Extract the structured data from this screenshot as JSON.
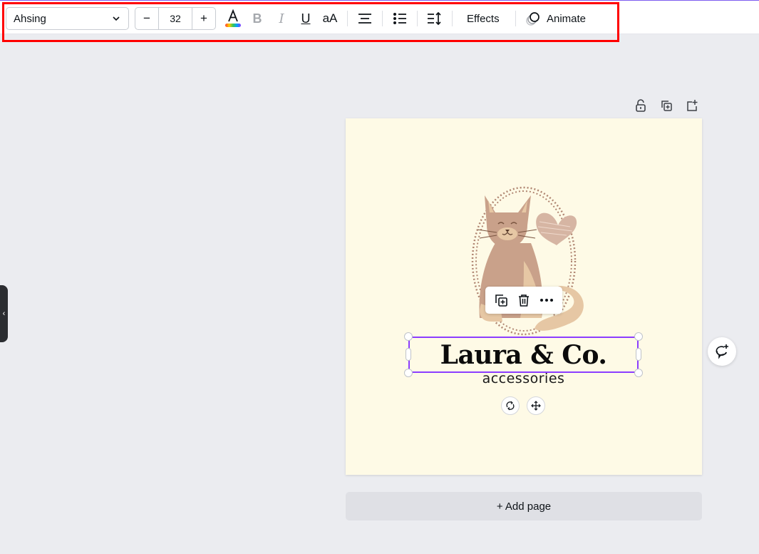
{
  "toolbar": {
    "font_family": "Ahsing",
    "font_size": "32",
    "decrease_label": "−",
    "increase_label": "+",
    "case_label": "aA",
    "effects_label": "Effects",
    "animate_label": "Animate",
    "icons": [
      "text-color-icon",
      "bold-icon",
      "italic-icon",
      "underline-icon",
      "letter-case-icon",
      "align-center-icon",
      "bullet-list-icon",
      "spacing-icon",
      "animate-icon"
    ]
  },
  "page_tools": {
    "icons": [
      "lock-icon",
      "duplicate-page-icon",
      "add-page-icon"
    ]
  },
  "design": {
    "title": "Laura & Co.",
    "subtitle": "accessories",
    "background_color": "#fefae6",
    "selection_color": "#8b3dff"
  },
  "context_menu": {
    "icons": [
      "duplicate-icon",
      "trash-icon",
      "more-icon"
    ]
  },
  "element_controls": {
    "icons": [
      "rotate-icon",
      "move-icon"
    ]
  },
  "add_page_label": "+ Add page",
  "side_tab_glyph": "‹",
  "colors": {
    "accent": "#8b3dff",
    "highlight_box": "#ff0000",
    "canvas_bg": "#ebecf0"
  }
}
